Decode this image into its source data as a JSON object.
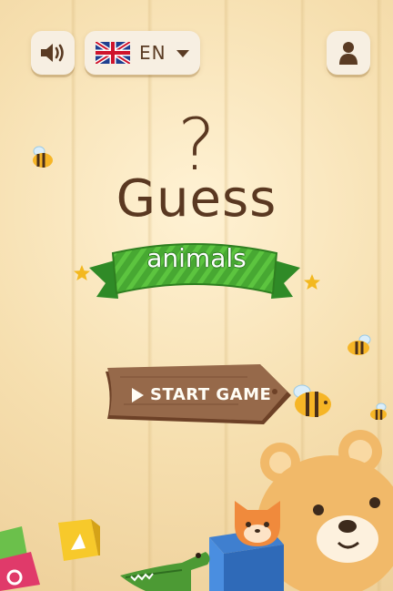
{
  "header": {
    "language": {
      "code": "EN",
      "flag": "uk-flag-icon"
    },
    "sound_icon": "speaker-icon",
    "profile_icon": "user-icon"
  },
  "title": {
    "question_mark": "?",
    "main": "Guess",
    "ribbon": "animals"
  },
  "start_button": {
    "label": "START GAME",
    "icon": "play-icon"
  },
  "colors": {
    "background": "#f6dfaf",
    "title_brown": "#5a3821",
    "ribbon_green": "#4caf36",
    "button_wood": "#8f6240",
    "button_text": "#fffdf5"
  },
  "decorations": [
    "bee-icon",
    "star-icon",
    "teddy-bear-icon",
    "cat-icon",
    "crocodile-icon",
    "toy-block-icon",
    "gift-box-icon"
  ]
}
